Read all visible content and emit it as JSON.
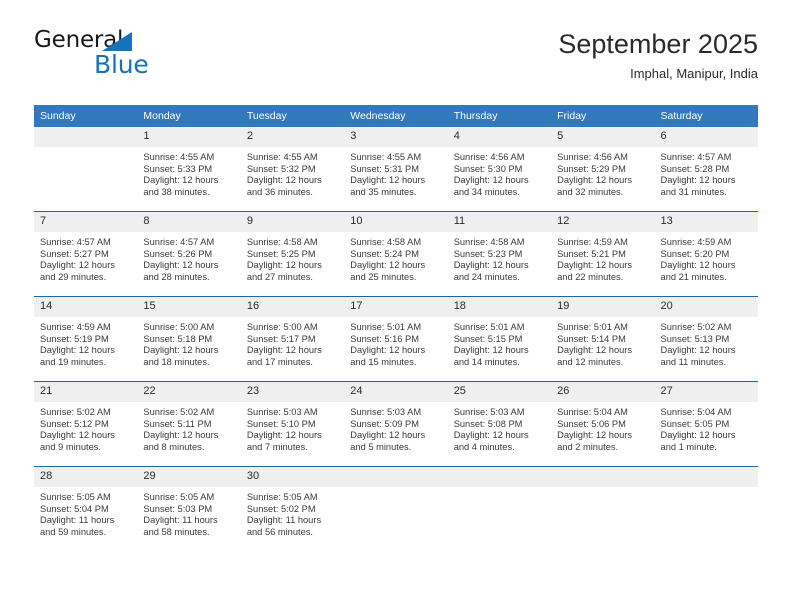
{
  "logo": {
    "word_one": "General",
    "word_two": "Blue",
    "triangle_color": "#1573bd",
    "text_color": "#1a1a1a"
  },
  "header": {
    "title": "September 2025",
    "subtitle": "Imphal, Manipur, India"
  },
  "theme": {
    "header_blue": "#3278bd",
    "row_divider_blue": "#1d66ab",
    "daynum_band": "#efefef"
  },
  "calendar": {
    "weekday_headers": [
      "Sunday",
      "Monday",
      "Tuesday",
      "Wednesday",
      "Thursday",
      "Friday",
      "Saturday"
    ],
    "weeks": [
      [
        {
          "day": "",
          "sunrise": "",
          "sunset": "",
          "daylight_line1": "",
          "daylight_line2": "",
          "empty": true
        },
        {
          "day": "1",
          "sunrise": "Sunrise: 4:55 AM",
          "sunset": "Sunset: 5:33 PM",
          "daylight_line1": "Daylight: 12 hours",
          "daylight_line2": "and 38 minutes.",
          "empty": false
        },
        {
          "day": "2",
          "sunrise": "Sunrise: 4:55 AM",
          "sunset": "Sunset: 5:32 PM",
          "daylight_line1": "Daylight: 12 hours",
          "daylight_line2": "and 36 minutes.",
          "empty": false
        },
        {
          "day": "3",
          "sunrise": "Sunrise: 4:55 AM",
          "sunset": "Sunset: 5:31 PM",
          "daylight_line1": "Daylight: 12 hours",
          "daylight_line2": "and 35 minutes.",
          "empty": false
        },
        {
          "day": "4",
          "sunrise": "Sunrise: 4:56 AM",
          "sunset": "Sunset: 5:30 PM",
          "daylight_line1": "Daylight: 12 hours",
          "daylight_line2": "and 34 minutes.",
          "empty": false
        },
        {
          "day": "5",
          "sunrise": "Sunrise: 4:56 AM",
          "sunset": "Sunset: 5:29 PM",
          "daylight_line1": "Daylight: 12 hours",
          "daylight_line2": "and 32 minutes.",
          "empty": false
        },
        {
          "day": "6",
          "sunrise": "Sunrise: 4:57 AM",
          "sunset": "Sunset: 5:28 PM",
          "daylight_line1": "Daylight: 12 hours",
          "daylight_line2": "and 31 minutes.",
          "empty": false
        }
      ],
      [
        {
          "day": "7",
          "sunrise": "Sunrise: 4:57 AM",
          "sunset": "Sunset: 5:27 PM",
          "daylight_line1": "Daylight: 12 hours",
          "daylight_line2": "and 29 minutes.",
          "empty": false
        },
        {
          "day": "8",
          "sunrise": "Sunrise: 4:57 AM",
          "sunset": "Sunset: 5:26 PM",
          "daylight_line1": "Daylight: 12 hours",
          "daylight_line2": "and 28 minutes.",
          "empty": false
        },
        {
          "day": "9",
          "sunrise": "Sunrise: 4:58 AM",
          "sunset": "Sunset: 5:25 PM",
          "daylight_line1": "Daylight: 12 hours",
          "daylight_line2": "and 27 minutes.",
          "empty": false
        },
        {
          "day": "10",
          "sunrise": "Sunrise: 4:58 AM",
          "sunset": "Sunset: 5:24 PM",
          "daylight_line1": "Daylight: 12 hours",
          "daylight_line2": "and 25 minutes.",
          "empty": false
        },
        {
          "day": "11",
          "sunrise": "Sunrise: 4:58 AM",
          "sunset": "Sunset: 5:23 PM",
          "daylight_line1": "Daylight: 12 hours",
          "daylight_line2": "and 24 minutes.",
          "empty": false
        },
        {
          "day": "12",
          "sunrise": "Sunrise: 4:59 AM",
          "sunset": "Sunset: 5:21 PM",
          "daylight_line1": "Daylight: 12 hours",
          "daylight_line2": "and 22 minutes.",
          "empty": false
        },
        {
          "day": "13",
          "sunrise": "Sunrise: 4:59 AM",
          "sunset": "Sunset: 5:20 PM",
          "daylight_line1": "Daylight: 12 hours",
          "daylight_line2": "and 21 minutes.",
          "empty": false
        }
      ],
      [
        {
          "day": "14",
          "sunrise": "Sunrise: 4:59 AM",
          "sunset": "Sunset: 5:19 PM",
          "daylight_line1": "Daylight: 12 hours",
          "daylight_line2": "and 19 minutes.",
          "empty": false
        },
        {
          "day": "15",
          "sunrise": "Sunrise: 5:00 AM",
          "sunset": "Sunset: 5:18 PM",
          "daylight_line1": "Daylight: 12 hours",
          "daylight_line2": "and 18 minutes.",
          "empty": false
        },
        {
          "day": "16",
          "sunrise": "Sunrise: 5:00 AM",
          "sunset": "Sunset: 5:17 PM",
          "daylight_line1": "Daylight: 12 hours",
          "daylight_line2": "and 17 minutes.",
          "empty": false
        },
        {
          "day": "17",
          "sunrise": "Sunrise: 5:01 AM",
          "sunset": "Sunset: 5:16 PM",
          "daylight_line1": "Daylight: 12 hours",
          "daylight_line2": "and 15 minutes.",
          "empty": false
        },
        {
          "day": "18",
          "sunrise": "Sunrise: 5:01 AM",
          "sunset": "Sunset: 5:15 PM",
          "daylight_line1": "Daylight: 12 hours",
          "daylight_line2": "and 14 minutes.",
          "empty": false
        },
        {
          "day": "19",
          "sunrise": "Sunrise: 5:01 AM",
          "sunset": "Sunset: 5:14 PM",
          "daylight_line1": "Daylight: 12 hours",
          "daylight_line2": "and 12 minutes.",
          "empty": false
        },
        {
          "day": "20",
          "sunrise": "Sunrise: 5:02 AM",
          "sunset": "Sunset: 5:13 PM",
          "daylight_line1": "Daylight: 12 hours",
          "daylight_line2": "and 11 minutes.",
          "empty": false
        }
      ],
      [
        {
          "day": "21",
          "sunrise": "Sunrise: 5:02 AM",
          "sunset": "Sunset: 5:12 PM",
          "daylight_line1": "Daylight: 12 hours",
          "daylight_line2": "and 9 minutes.",
          "empty": false
        },
        {
          "day": "22",
          "sunrise": "Sunrise: 5:02 AM",
          "sunset": "Sunset: 5:11 PM",
          "daylight_line1": "Daylight: 12 hours",
          "daylight_line2": "and 8 minutes.",
          "empty": false
        },
        {
          "day": "23",
          "sunrise": "Sunrise: 5:03 AM",
          "sunset": "Sunset: 5:10 PM",
          "daylight_line1": "Daylight: 12 hours",
          "daylight_line2": "and 7 minutes.",
          "empty": false
        },
        {
          "day": "24",
          "sunrise": "Sunrise: 5:03 AM",
          "sunset": "Sunset: 5:09 PM",
          "daylight_line1": "Daylight: 12 hours",
          "daylight_line2": "and 5 minutes.",
          "empty": false
        },
        {
          "day": "25",
          "sunrise": "Sunrise: 5:03 AM",
          "sunset": "Sunset: 5:08 PM",
          "daylight_line1": "Daylight: 12 hours",
          "daylight_line2": "and 4 minutes.",
          "empty": false
        },
        {
          "day": "26",
          "sunrise": "Sunrise: 5:04 AM",
          "sunset": "Sunset: 5:06 PM",
          "daylight_line1": "Daylight: 12 hours",
          "daylight_line2": "and 2 minutes.",
          "empty": false
        },
        {
          "day": "27",
          "sunrise": "Sunrise: 5:04 AM",
          "sunset": "Sunset: 5:05 PM",
          "daylight_line1": "Daylight: 12 hours",
          "daylight_line2": "and 1 minute.",
          "empty": false
        }
      ],
      [
        {
          "day": "28",
          "sunrise": "Sunrise: 5:05 AM",
          "sunset": "Sunset: 5:04 PM",
          "daylight_line1": "Daylight: 11 hours",
          "daylight_line2": "and 59 minutes.",
          "empty": false
        },
        {
          "day": "29",
          "sunrise": "Sunrise: 5:05 AM",
          "sunset": "Sunset: 5:03 PM",
          "daylight_line1": "Daylight: 11 hours",
          "daylight_line2": "and 58 minutes.",
          "empty": false
        },
        {
          "day": "30",
          "sunrise": "Sunrise: 5:05 AM",
          "sunset": "Sunset: 5:02 PM",
          "daylight_line1": "Daylight: 11 hours",
          "daylight_line2": "and 56 minutes.",
          "empty": false
        },
        {
          "day": "",
          "sunrise": "",
          "sunset": "",
          "daylight_line1": "",
          "daylight_line2": "",
          "empty": true
        },
        {
          "day": "",
          "sunrise": "",
          "sunset": "",
          "daylight_line1": "",
          "daylight_line2": "",
          "empty": true
        },
        {
          "day": "",
          "sunrise": "",
          "sunset": "",
          "daylight_line1": "",
          "daylight_line2": "",
          "empty": true
        },
        {
          "day": "",
          "sunrise": "",
          "sunset": "",
          "daylight_line1": "",
          "daylight_line2": "",
          "empty": true
        }
      ]
    ]
  }
}
